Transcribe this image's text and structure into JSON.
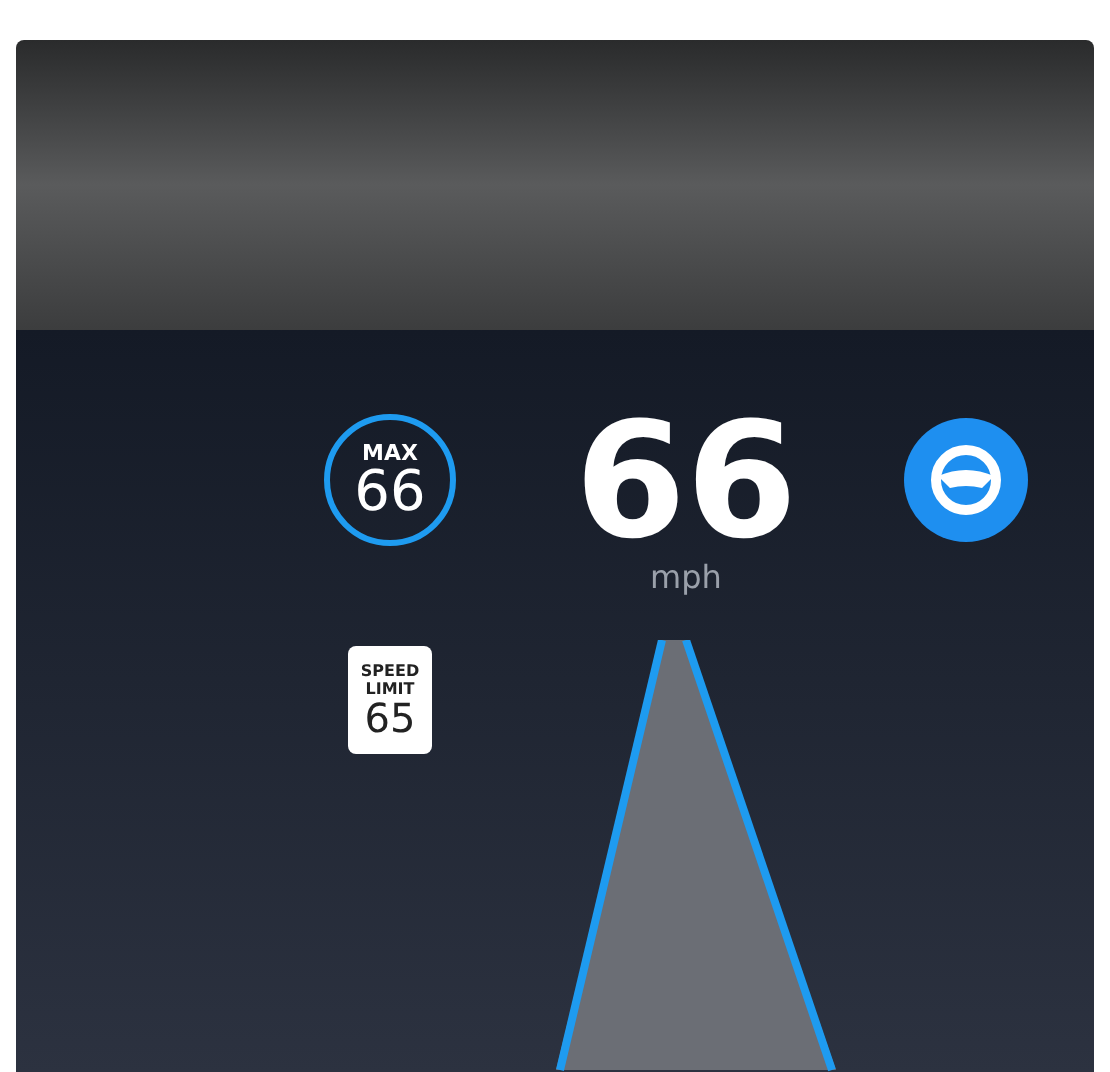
{
  "set_speed": {
    "label": "MAX",
    "value": "66"
  },
  "speed": {
    "value": "66",
    "unit": "mph"
  },
  "autosteer": {
    "on": true
  },
  "speed_limit_sign": {
    "line_1": "SPEED",
    "line_2": "LIMIT",
    "value": "65"
  }
}
